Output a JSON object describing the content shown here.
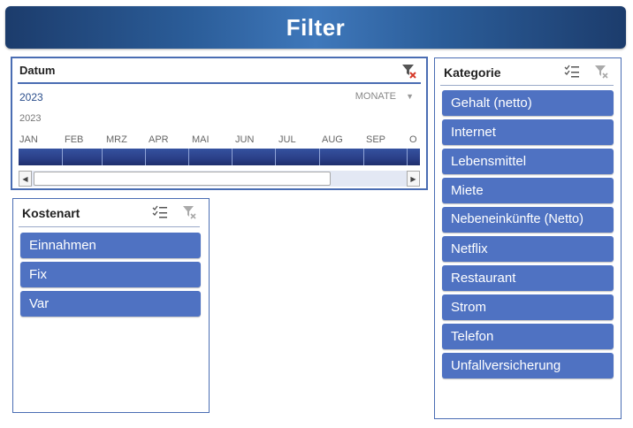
{
  "banner": {
    "title": "Filter"
  },
  "timeline": {
    "header": "Datum",
    "selection_label": "2023",
    "time_level": "MONATE",
    "year_label": "2023",
    "months": [
      "JAN",
      "FEB",
      "MRZ",
      "APR",
      "MAI",
      "JUN",
      "JUL",
      "AUG",
      "SEP",
      "O"
    ]
  },
  "kostenart": {
    "title": "Kostenart",
    "items": [
      {
        "label": "Einnahmen"
      },
      {
        "label": "Fix"
      },
      {
        "label": "Var"
      }
    ]
  },
  "kategorie": {
    "title": "Kategorie",
    "items": [
      {
        "label": "Gehalt (netto)"
      },
      {
        "label": "Internet"
      },
      {
        "label": "Lebensmittel"
      },
      {
        "label": "Miete"
      },
      {
        "label": "Nebeneinkünfte (Netto)"
      },
      {
        "label": "Netflix"
      },
      {
        "label": "Restaurant"
      },
      {
        "label": "Strom"
      },
      {
        "label": "Telefon"
      },
      {
        "label": "Unfallversicherung"
      }
    ]
  },
  "colors": {
    "banner": "#2b5d99",
    "slicer_item": "#4f72c2",
    "timeline_bar": "#2a3f87",
    "panel_border": "#4a6db3"
  }
}
